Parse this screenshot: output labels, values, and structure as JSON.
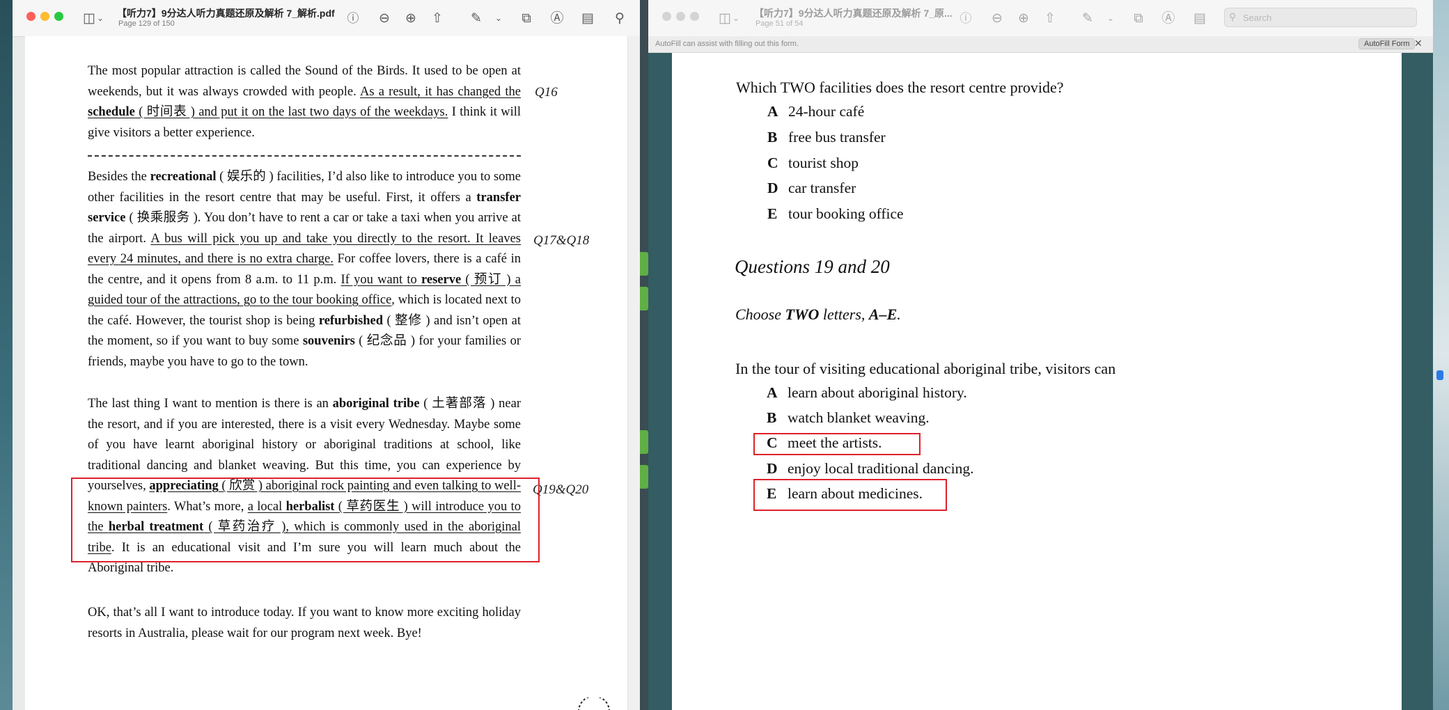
{
  "left_window": {
    "title": "【听力7】9分达人听力真题还原及解析 7_解析.pdf",
    "page_info": "Page 129 of 150",
    "paragraphs": {
      "p1_a": "The most popular attraction is called the Sound of the Birds. It used to be open at weekends, but it was always crowded with people. ",
      "p1_u1": "As a result, it has changed the ",
      "p1_b1": "schedule",
      "p1_u2": " ( 时间表 ) and put it on the last two days of the weekdays.",
      "p1_c": " I think it will give visitors a better experience.",
      "p2_a": "Besides the ",
      "p2_b1": "recreational",
      "p2_c": " ( 娱乐的 ) facilities, I’d also like to introduce you to some other facilities in the resort centre that may be useful. First, it offers a ",
      "p2_b2": "transfer service",
      "p2_d": " ( 换乘服务 ). You don’t have to rent a car or take a taxi when you arrive at the airport. ",
      "p2_u1": "A bus will pick you up and take you directly to the resort. It leaves every 24 minutes, and there is no extra charge.",
      "p2_e": " For coffee lovers, there is a café in the centre, and it opens from 8 a.m. to 11 p.m. ",
      "p2_u2": "If you want to ",
      "p2_b3": "reserve",
      "p2_u3": " ( 预订 ) a guided tour of the attractions, go to the tour booking office",
      "p2_f": ", which is located next to the café. However, the tourist shop is being ",
      "p2_b4": "refurbished",
      "p2_g": " ( 整修 ) and isn’t open at the moment, so if you want to buy some ",
      "p2_b5": "souvenirs",
      "p2_h": " ( 纪念品 ) for your families or friends, maybe you have to go to the town.",
      "p3_a": "The last thing I want to mention is there is an ",
      "p3_b1": "aboriginal tribe",
      "p3_c": " ( 土著部落 ) near the resort, and if you are interested, there is a visit every Wednesday. Maybe some of you have learnt aboriginal history or aboriginal traditions at school, like traditional dancing and blanket weaving. But this time, you can experience by yourselves, ",
      "p3_b2": "appreciating",
      "p3_u1": " ( 欣赏 ) aboriginal rock painting and even talking to well-known painters",
      "p3_d": ". What’s more, ",
      "p3_u2": "a local ",
      "p3_b3": "herbalist",
      "p3_u3": " ( 草药医生 ) will introduce you to the ",
      "p3_b4": "herbal treatment",
      "p3_u4": " ( 草药治疗 ), which is commonly used in the aboriginal tribe",
      "p3_e": ". It is an educational visit and I’m sure you will learn much about the Aboriginal tribe.",
      "p4": "OK, that’s all I want to introduce today. If you want to know more exciting holiday resorts in Australia, please wait for our program next week. Bye!"
    },
    "labels": {
      "q16": "Q16",
      "q17_18": "Q17&Q18",
      "q19_20": "Q19&Q20"
    }
  },
  "right_window": {
    "title": "【听力7】9分达人听力真题还原及解析 7_原...",
    "page_info": "Page 51 of 54",
    "search_placeholder": "Search",
    "autofill_message": "AutoFill can assist with filling out this form.",
    "autofill_button": "AutoFill Form",
    "q17_stem": "Which TWO facilities does the resort centre provide?",
    "q17_options": [
      {
        "letter": "A",
        "text": "24-hour café"
      },
      {
        "letter": "B",
        "text": "free bus transfer"
      },
      {
        "letter": "C",
        "text": "tourist shop"
      },
      {
        "letter": "D",
        "text": "car transfer"
      },
      {
        "letter": "E",
        "text": "tour booking office"
      }
    ],
    "q19_heading": "Questions 19 and 20",
    "instr_a": "Choose ",
    "instr_b": "TWO",
    "instr_c": " letters, ",
    "instr_d": "A–E",
    "instr_e": ".",
    "q19_stem": "In the tour of visiting educational aboriginal tribe, visitors can",
    "q19_options": [
      {
        "letter": "A",
        "text": "learn about aboriginal history."
      },
      {
        "letter": "B",
        "text": "watch blanket weaving."
      },
      {
        "letter": "C",
        "text": "meet the artists."
      },
      {
        "letter": "D",
        "text": "enjoy local traditional dancing."
      },
      {
        "letter": "E",
        "text": "learn about medicines."
      }
    ]
  },
  "colors": {
    "highlight_box": "#e0202b",
    "traffic_close": "#fe5f57",
    "traffic_min": "#febc2e",
    "traffic_max": "#28c840"
  }
}
